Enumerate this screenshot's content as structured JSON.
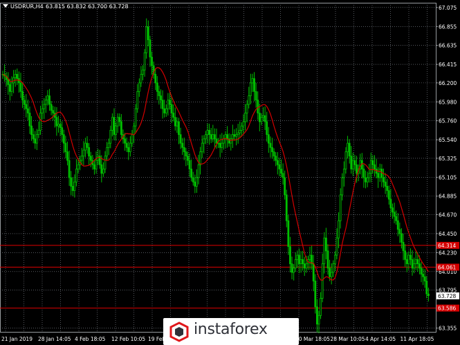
{
  "header": {
    "symbol_timeframe": "USDRUR,H4",
    "ohlc": "63.815 63.832 63.700 63.728"
  },
  "colors": {
    "background": "#000000",
    "grid": "#8a8f99",
    "bull_candle": "#00c000",
    "moving_average": "#d40000",
    "level_line": "#e00000",
    "axis_text": "#ffffff",
    "price_tag": "#ffffff",
    "level_tag": "#d40000"
  },
  "logo": {
    "text": "instaforex",
    "icon": "instaforex-logo-icon"
  },
  "chart_data": {
    "type": "candlestick",
    "symbol": "USDRUR",
    "timeframe": "H4",
    "y_ticks": [
      "67.075",
      "66.855",
      "66.635",
      "66.415",
      "66.200",
      "65.980",
      "65.760",
      "65.540",
      "65.325",
      "65.105",
      "64.885",
      "64.670",
      "64.450",
      "64.230",
      "64.010",
      "63.795",
      "63.355"
    ],
    "ylim": [
      63.31,
      67.13
    ],
    "x_ticks": [
      "21 Jan 2019",
      "28 Jan 14:05",
      "4 Feb 18:05",
      "12 Feb 10:05",
      "19 Feb",
      "20 Mar 18:05",
      "28 Mar 10:05",
      "4 Apr 14:05",
      "11 Apr 18:05"
    ],
    "grid": true,
    "current_price": "63.728",
    "levels": [
      {
        "label": "64.314",
        "value": 64.314
      },
      {
        "label": "64.061",
        "value": 64.061
      },
      {
        "label": "63.586",
        "value": 63.586
      }
    ],
    "close_series": [
      66.3,
      66.28,
      66.24,
      66.18,
      66.1,
      66.2,
      66.26,
      66.3,
      66.25,
      66.2,
      66.1,
      66.0,
      65.95,
      65.9,
      65.85,
      65.7,
      65.6,
      65.55,
      65.5,
      65.6,
      65.65,
      65.85,
      65.9,
      65.95,
      66.0,
      66.05,
      65.95,
      65.88,
      65.85,
      65.8,
      65.7,
      65.72,
      65.68,
      65.6,
      65.5,
      65.4,
      65.3,
      65.1,
      65.0,
      64.95,
      65.05,
      65.2,
      65.25,
      65.3,
      65.35,
      65.42,
      65.5,
      65.45,
      65.35,
      65.3,
      65.25,
      65.2,
      65.3,
      65.35,
      65.25,
      65.15,
      65.2,
      65.35,
      65.45,
      65.5,
      65.65,
      65.8,
      65.6,
      65.7,
      65.8,
      65.75,
      65.6,
      65.55,
      65.5,
      65.45,
      65.4,
      65.5,
      65.6,
      65.7,
      65.9,
      66.1,
      66.2,
      66.3,
      66.35,
      66.55,
      66.85,
      66.7,
      66.5,
      66.4,
      66.3,
      66.2,
      66.1,
      66.05,
      66.0,
      65.9,
      65.85,
      65.9,
      66.0,
      65.95,
      65.85,
      65.8,
      65.7,
      65.75,
      65.6,
      65.5,
      65.45,
      65.4,
      65.35,
      65.3,
      65.2,
      65.1,
      65.05,
      65.0,
      65.1,
      65.25,
      65.4,
      65.5,
      65.55,
      65.6,
      65.65,
      65.6,
      65.55,
      65.6,
      65.55,
      65.5,
      65.5,
      65.45,
      65.5,
      65.55,
      65.6,
      65.55,
      65.5,
      65.55,
      65.6,
      65.58,
      65.6,
      65.62,
      65.65,
      65.7,
      65.75,
      65.85,
      65.95,
      66.05,
      66.2,
      66.25,
      66.1,
      66.0,
      65.85,
      65.75,
      65.8,
      65.82,
      65.75,
      65.6,
      65.5,
      65.45,
      65.4,
      65.35,
      65.3,
      65.25,
      65.2,
      65.15,
      65.1,
      64.9,
      64.6,
      64.3,
      64.1,
      64.0,
      64.05,
      64.15,
      64.2,
      64.1,
      64.15,
      64.1,
      64.05,
      64.1,
      64.15,
      64.2,
      64.1,
      63.9,
      63.6,
      63.4,
      63.5,
      63.7,
      64.1,
      64.4,
      64.25,
      64.05,
      63.95,
      64.0,
      64.1,
      64.2,
      64.4,
      64.6,
      64.9,
      65.1,
      65.2,
      65.4,
      65.5,
      65.35,
      65.2,
      65.3,
      65.25,
      65.15,
      65.2,
      65.3,
      65.2,
      65.1,
      65.05,
      65.1,
      65.15,
      65.3,
      65.25,
      65.2,
      65.15,
      65.1,
      65.2,
      65.1,
      65.05,
      65.0,
      64.95,
      64.85,
      64.75,
      64.7,
      64.65,
      64.6,
      64.5,
      64.45,
      64.35,
      64.25,
      64.15,
      64.1,
      64.2,
      64.15,
      64.05,
      64.1,
      64.15,
      64.1,
      64.05,
      63.98,
      63.95,
      63.9,
      63.75,
      63.73
    ]
  }
}
